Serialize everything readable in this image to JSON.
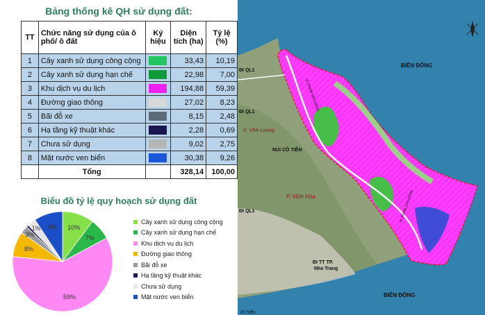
{
  "table_title": "Bảng thống kê QH sử dụng đất:",
  "headers": {
    "tt": "TT",
    "func": "Chức năng sử dụng của ô phố/ ô đất",
    "sym": "Ký hiệu",
    "area": "Diện tích (ha)",
    "ratio": "Tỷ lệ (%)"
  },
  "rows": [
    {
      "tt": "1",
      "name": "Cây xanh sử dụng công cộng",
      "color": "#22c55e",
      "area": "33,43",
      "ratio": "10,19"
    },
    {
      "tt": "2",
      "name": "Cây xanh sử dụng hạn chế",
      "color": "#0f9a3a",
      "area": "22,98",
      "ratio": "7,00"
    },
    {
      "tt": "3",
      "name": "Khu dịch vụ du lịch",
      "color": "#ee22ee",
      "area": "194,88",
      "ratio": "59,39"
    },
    {
      "tt": "4",
      "name": "Đường giao thông",
      "color": "#d8d8d8",
      "area": "27,02",
      "ratio": "8,23"
    },
    {
      "tt": "5",
      "name": "Bãi đỗ xe",
      "color": "#5b6b7a",
      "area": "8,15",
      "ratio": "2,48"
    },
    {
      "tt": "6",
      "name": "Hạ tầng kỹ thuật khác",
      "color": "#1c1650",
      "area": "2,28",
      "ratio": "0,69"
    },
    {
      "tt": "7",
      "name": "Chưa sử dụng",
      "color": "#b5b5b5",
      "area": "9,02",
      "ratio": "2,75"
    },
    {
      "tt": "8",
      "name": "Mặt nước ven biển",
      "color": "#1a56d6",
      "area": "30,38",
      "ratio": "9,26"
    }
  ],
  "total": {
    "label": "Tổng",
    "area": "328,14",
    "ratio": "100,00"
  },
  "chart_title": "Biểu đồ tỷ lệ quy hoạch sử dụng đất",
  "chart_data": {
    "type": "pie",
    "labels": [
      "Cây xanh sử dụng công cộng",
      "Cây xanh sử dụng hạn chế",
      "Khu dịch vụ du lịch",
      "Đường giao thông",
      "Bãi đỗ xe",
      "Hạ tầng kỹ thuật khác",
      "Chưa sử dụng",
      "Mặt nước ven biển"
    ],
    "values": [
      10.19,
      7.0,
      59.39,
      8.23,
      2.48,
      0.69,
      2.75,
      9.26
    ],
    "data_labels": [
      "10%",
      "7%",
      "59%",
      "8%",
      "3%",
      "",
      "1%",
      "9%"
    ],
    "colors": [
      "#86e04a",
      "#2bb84a",
      "#ff88f4",
      "#f5b800",
      "#9a9aa0",
      "#1c1a5c",
      "#e6e6e6",
      "#1a4fc8"
    ],
    "legend_position": "right"
  },
  "map": {
    "labels": {
      "bien_dong_top": "BIỂN ĐÔNG",
      "bien_dong_bottom": "BIỂN ĐÔNG",
      "di_ql1_a": "ĐI QL1",
      "di_ql1_b": "ĐI QL1",
      "di_ql1_c": "ĐI QL1",
      "vinh_luong": "X. Vĩnh Lương",
      "nui_co_tien": "NÚI CÔ TIÊN",
      "vinh_hoa": "P. Vĩnh Hòa",
      "di_tt": "ĐI TT TP.",
      "nha_trang": "Nha Trang",
      "road1": "Đ. PHẠM VĂN ĐỒNG",
      "road2": "Đ. PHẠM VĂN ĐỒNG",
      "ki_hieu": "Kí hiệu"
    }
  }
}
